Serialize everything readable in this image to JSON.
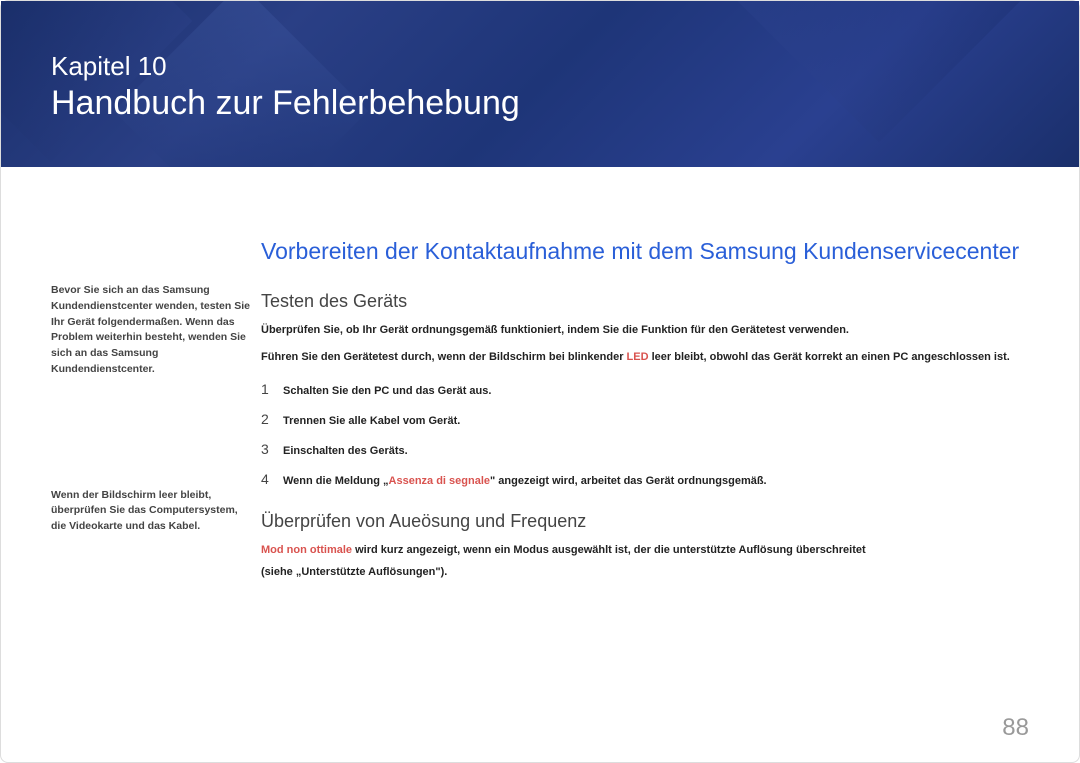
{
  "header": {
    "chapter_label": "Kapitel 10",
    "chapter_title": "Handbuch zur Fehlerbehebung"
  },
  "sidebar": {
    "note1_a": "Bevor Sie sich an das Samsung Kundendienstcenter wenden, testen Sie Ihr Gerät folgendermaßen. Wenn das Problem weiterhin besteht, wenden Sie sich an das Samsung",
    "note1_b": "Kundendienstcenter.",
    "note2": "Wenn der Bildschirm leer bleibt, überprüfen Sie das Computersystem, die Videokarte und das Kabel."
  },
  "main": {
    "section_heading": "Vorbereiten der Kontaktaufnahme mit dem Samsung Kundenservicecenter",
    "sub_heading_1": "Testen des Geräts",
    "body_1": "Überprüfen Sie, ob Ihr Gerät ordnungsgemäß funktioniert, indem Sie die Funktion für den Gerätetest verwenden.",
    "body_2a": "Führen Sie den Gerätetest durch, wenn der Bildschirm bei blinkender",
    "body_2_red": "LED",
    "body_2b": "leer bleibt, obwohl das Gerät korrekt an einen PC angeschlossen ist.",
    "steps": [
      {
        "num": "1",
        "text": "Schalten Sie den PC und das Gerät aus."
      },
      {
        "num": "2",
        "text": "Trennen Sie alle Kabel vom Gerät."
      },
      {
        "num": "3",
        "text": "Einschalten des Geräts."
      },
      {
        "num": "4",
        "text_a": "Wenn die Meldung „",
        "red": "Assenza di segnale",
        "text_b": "\" angezeigt wird, arbeitet das Gerät ordnungsgemäß."
      }
    ],
    "sub_heading_2": "Überprüfen von Aueösung und Frequenz",
    "para2_red": "Mod non ottimale",
    "para2_a": " wird kurz angezeigt, wenn ein Modus ausgewählt ist, der die unterstützte Auflösung überschreitet",
    "para2_b": "(siehe „Unterstützte Auflösungen\")."
  },
  "page_number": "88"
}
